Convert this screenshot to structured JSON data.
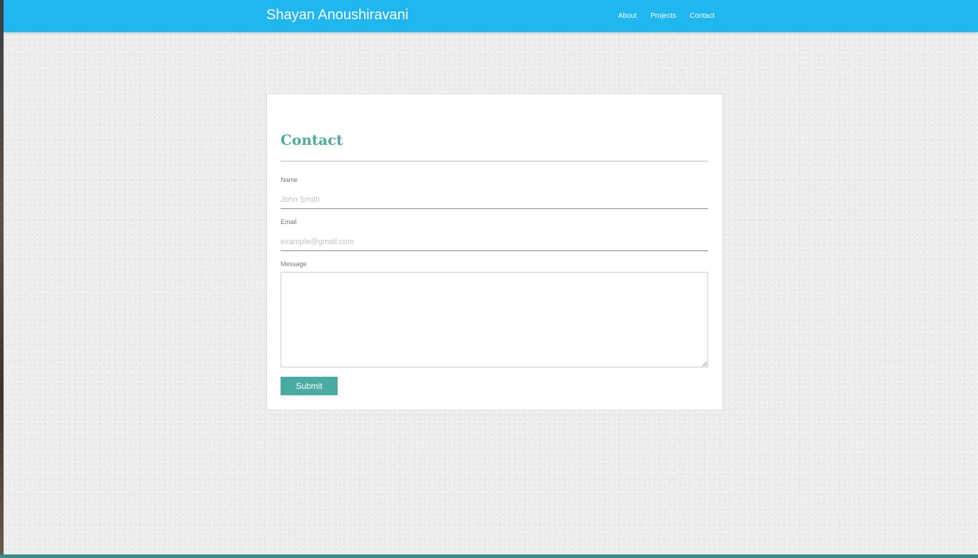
{
  "header": {
    "brand": "Shayan Anoushiravani",
    "nav": [
      {
        "label": "About"
      },
      {
        "label": "Projects"
      },
      {
        "label": "Contact"
      }
    ]
  },
  "contact_form": {
    "title": "Contact",
    "fields": {
      "name": {
        "label": "Name",
        "placeholder": "John Smith",
        "value": ""
      },
      "email": {
        "label": "Email",
        "placeholder": "example@gmail.com",
        "value": ""
      },
      "message": {
        "label": "Message",
        "value": ""
      }
    },
    "submit_label": "Submit"
  },
  "colors": {
    "navbar": "#20b6ef",
    "accent": "#4aaba3",
    "background": "#ececec"
  }
}
